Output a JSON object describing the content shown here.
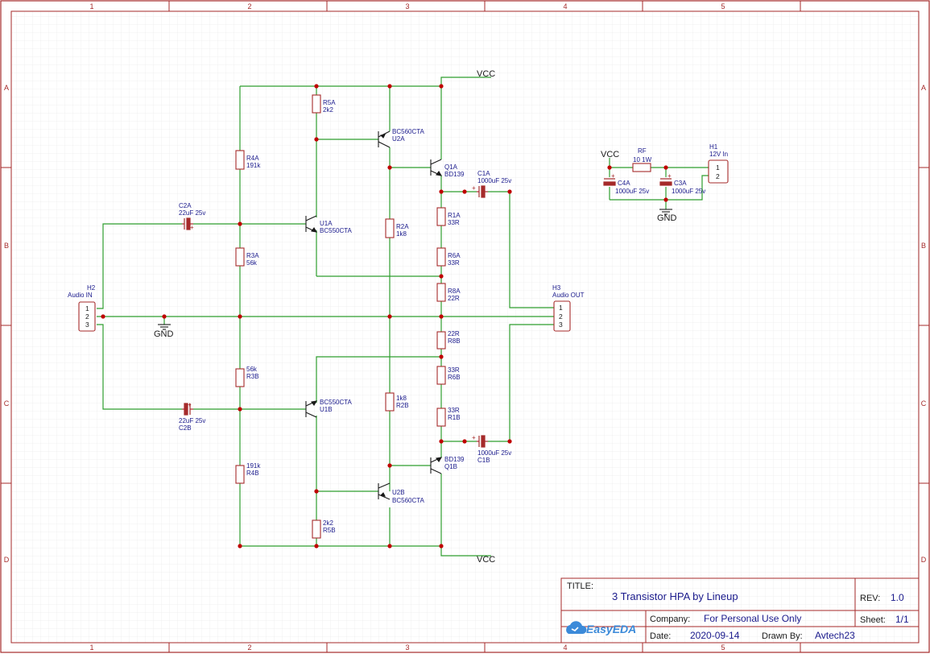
{
  "frame": {
    "col_labels": [
      "1",
      "2",
      "3",
      "4",
      "5"
    ],
    "row_labels": [
      "A",
      "B",
      "C",
      "D"
    ]
  },
  "title_block": {
    "title_label": "TITLE:",
    "title": "3 Transistor HPA by Lineup",
    "rev_label": "REV:",
    "rev": "1.0",
    "logo_text": "EasyEDA",
    "company_label": "Company:",
    "company": "For Personal Use Only",
    "sheet_label": "Sheet:",
    "sheet": "1/1",
    "date_label": "Date:",
    "date": "2020-09-14",
    "drawn_label": "Drawn By:",
    "drawn_by": "Avtech23"
  },
  "power": {
    "vcc": "VCC",
    "gnd": "GND"
  },
  "components": {
    "r5a_ref": "R5A",
    "r5a_val": "2k2",
    "r4a_ref": "R4A",
    "r4a_val": "191k",
    "r3a_ref": "R3A",
    "r3a_val": "56k",
    "r2a_ref": "R2A",
    "r2a_val": "1k8",
    "r1a_ref": "R1A",
    "r1a_val": "33R",
    "r6a_ref": "R6A",
    "r6a_val": "33R",
    "r8a_ref": "R8A",
    "r8a_val": "22R",
    "r8b_ref": "R8B",
    "r8b_val": "22R",
    "r6b_ref": "R6B",
    "r6b_val": "33R",
    "r1b_ref": "R1B",
    "r1b_val": "33R",
    "r3b_ref": "R3B",
    "r3b_val": "56k",
    "r2b_ref": "R2B",
    "r2b_val": "1k8",
    "r4b_ref": "R4B",
    "r4b_val": "191k",
    "r5b_ref": "R5B",
    "r5b_val": "2k2",
    "u2a_ref": "U2A",
    "u2a_val": "BC560CTA",
    "u1a_ref": "U1A",
    "u1a_val": "BC550CTA",
    "q1a_ref": "Q1A",
    "q1a_val": "BD139",
    "u1b_ref": "U1B",
    "u1b_val": "BC550CTA",
    "u2b_ref": "U2B",
    "u2b_val": "BC560CTA",
    "q1b_ref": "Q1B",
    "q1b_val": "BD139",
    "c1a_ref": "C1A",
    "c1a_val": "1000uF 25v",
    "c1b_ref": "C1B",
    "c1b_val": "1000uF 25v",
    "c2a_ref": "C2A",
    "c2a_val": "22uF 25v",
    "c2b_ref": "C2B",
    "c2b_val": "22uF 25v",
    "c4a_ref": "C4A",
    "c4a_val": "1000uF 25v",
    "c3a_ref": "C3A",
    "c3a_val": "1000uF 25v",
    "rf_ref": "RF",
    "rf_val": "10 1W",
    "h1_ref": "H1",
    "h1_val": "12V In",
    "h2_ref": "H2",
    "h2_val": "Audio IN",
    "h3_ref": "H3",
    "h3_val": "Audio OUT",
    "pin1": "1",
    "pin2": "2",
    "pin3": "3"
  },
  "colors": {
    "frame": "#a52a2a",
    "wire": "#2e9e2e",
    "part": "#a52a2a",
    "junction": "#c00000",
    "text": "#1a1a8c",
    "grid": "#e8e8e8"
  }
}
